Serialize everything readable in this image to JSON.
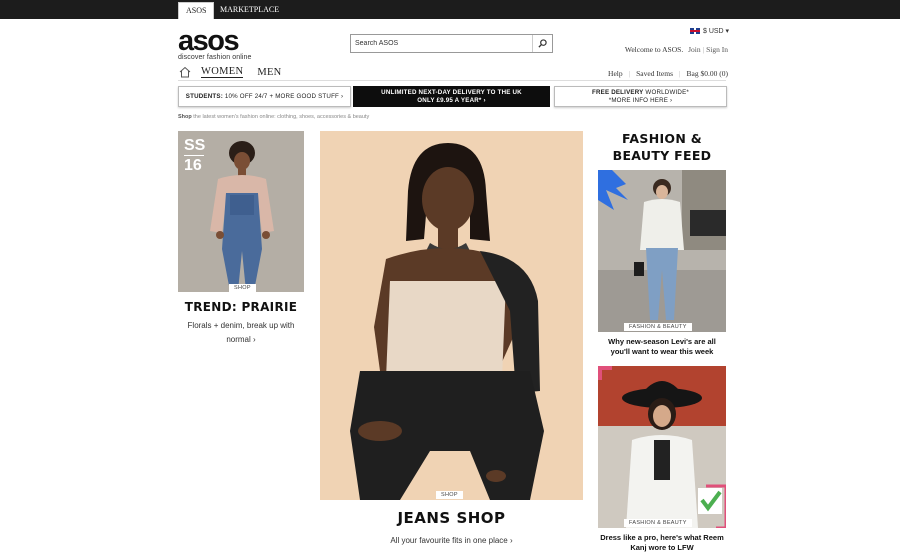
{
  "topbar": {
    "tab_asos": "ASOS",
    "tab_marketplace": "MARKETPLACE"
  },
  "logo": {
    "text": "asos",
    "tagline": "discover fashion online"
  },
  "search": {
    "placeholder": "Search ASOS",
    "icon": "search-icon"
  },
  "currency": {
    "label": "$ USD ▾"
  },
  "account": {
    "welcome": "Welcome to ASOS.",
    "join": "Join",
    "sign_in": "Sign In"
  },
  "nav": {
    "home_icon": "home-icon",
    "women": "WOMEN",
    "men": "MEN"
  },
  "utility": {
    "help": "Help",
    "saved": "Saved Items",
    "bag": "Bag",
    "bag_total": "$0.00 (0)"
  },
  "promos": {
    "students_bold": "STUDENTS:",
    "students_text": " 10% OFF 24/7 + MORE GOOD STUFF ›",
    "delivery_line1": "UNLIMITED NEXT-DAY DELIVERY TO THE UK",
    "delivery_line2": "ONLY £9.95 A YEAR* ›",
    "free_bold": "FREE DELIVERY",
    "free_text": " WORLDWIDE*",
    "free_line2": "*MORE INFO HERE ›"
  },
  "breadcrumb": {
    "bold": "Shop",
    "text": " the latest women's fashion online: clothing, shoes, accessories & beauty"
  },
  "left_card": {
    "badge_top": "SS",
    "badge_bottom": "16",
    "tag": "SHOP",
    "title": "TREND: PRAIRIE",
    "subtitle": "Florals + denim, break up with normal ›"
  },
  "center_card": {
    "tag": "SHOP",
    "title": "JEANS SHOP",
    "subtitle": "All your favourite fits in one place ›"
  },
  "feed": {
    "title_line1": "FASHION &",
    "title_line2": "BEAUTY FEED",
    "item1_tag": "FASHION & BEAUTY",
    "item1_caption": "Why new-season Levi's are all you'll want to wear this week",
    "item2_tag": "FASHION & BEAUTY",
    "item2_caption": "Dress like a pro, here's what Reem Kanj wore to LFW"
  },
  "colors": {
    "topbar": "#1c1c1c",
    "promo_dark": "#0d0d0d",
    "center_bg": "#f0d4b6",
    "accent_blue": "#2f6fe0",
    "accent_pink": "#e0507a",
    "accent_green": "#4caf50"
  }
}
